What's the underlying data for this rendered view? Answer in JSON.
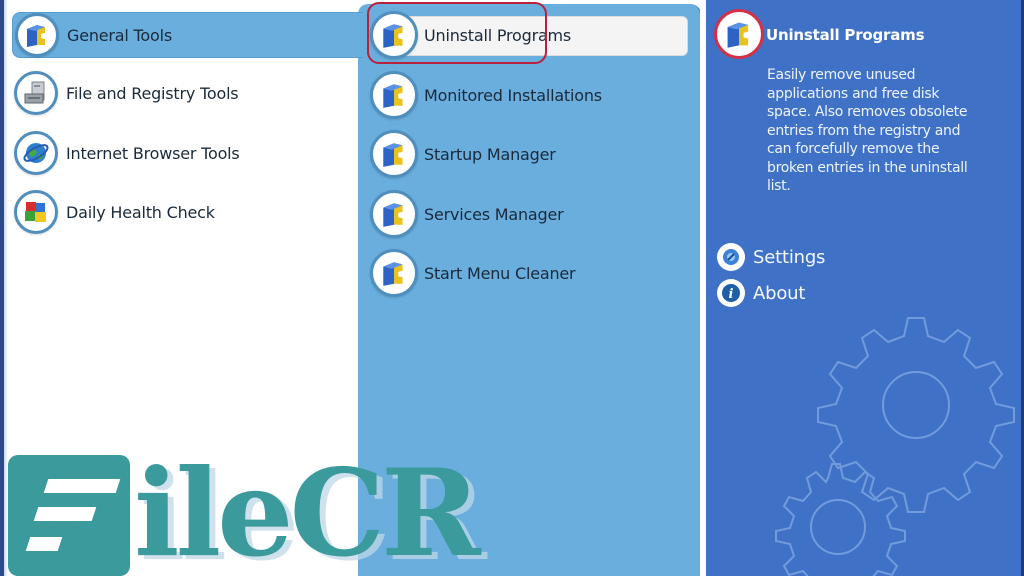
{
  "categories": [
    {
      "label": "General Tools",
      "icon": "cube-puzzle-icon",
      "selected": true
    },
    {
      "label": "File and Registry Tools",
      "icon": "file-cabinet-icon",
      "selected": false
    },
    {
      "label": "Internet Browser Tools",
      "icon": "globe-icon",
      "selected": false
    },
    {
      "label": "Daily Health Check",
      "icon": "colored-blocks-icon",
      "selected": false
    }
  ],
  "tools": [
    {
      "label": "Uninstall Programs",
      "icon": "cube-puzzle-icon",
      "selected": true
    },
    {
      "label": "Monitored Installations",
      "icon": "cube-puzzle-icon",
      "selected": false
    },
    {
      "label": "Startup Manager",
      "icon": "cube-puzzle-icon",
      "selected": false
    },
    {
      "label": "Services Manager",
      "icon": "cube-puzzle-icon",
      "selected": false
    },
    {
      "label": "Start Menu Cleaner",
      "icon": "cube-puzzle-icon",
      "selected": false
    }
  ],
  "detail": {
    "title": "Uninstall Programs",
    "description": "Easily remove unused applications and free disk space. Also removes obsolete entries from the registry and can forcefully remove the broken entries in the uninstall list."
  },
  "links": [
    {
      "label": "Settings",
      "icon": "settings-icon"
    },
    {
      "label": "About",
      "icon": "info-icon"
    }
  ],
  "watermark": {
    "text": "ileCR"
  },
  "colors": {
    "middle_panel": "#6aaede",
    "right_panel": "#3f72c6",
    "highlight": "#b8203c",
    "watermark": "#3a9a9c"
  }
}
